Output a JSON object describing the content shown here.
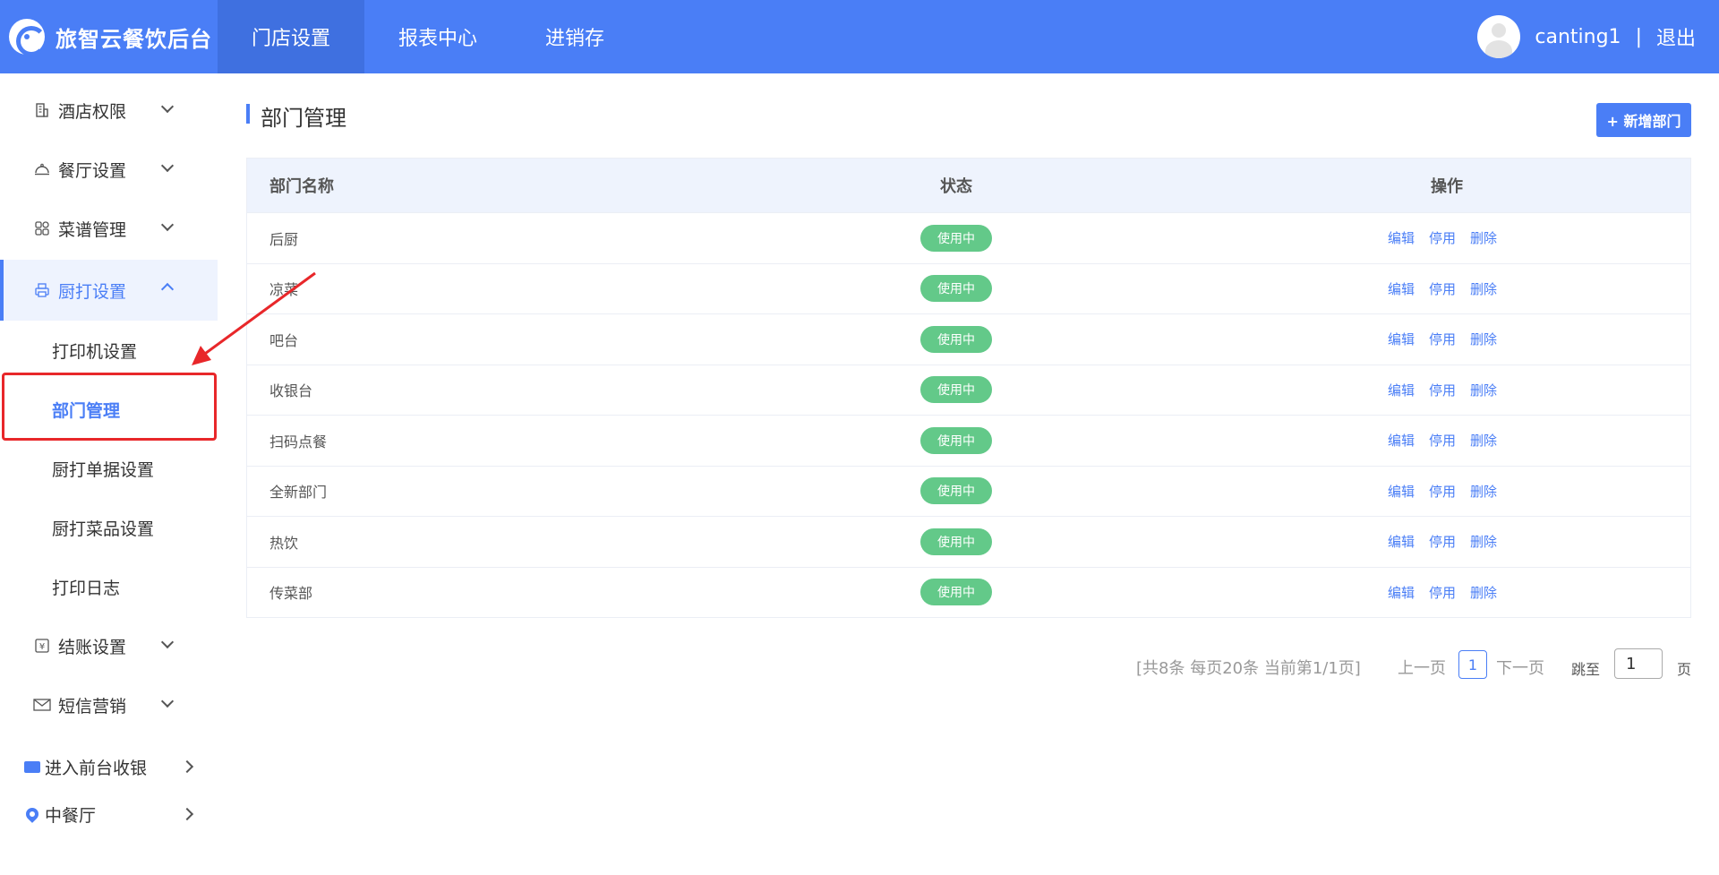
{
  "app": {
    "title": "旅智云餐饮后台"
  },
  "topnav": [
    {
      "label": "门店设置",
      "active": true
    },
    {
      "label": "报表中心",
      "active": false
    },
    {
      "label": "进销存",
      "active": false
    }
  ],
  "user": {
    "name": "canting1",
    "separator": "|",
    "logout": "退出"
  },
  "sidebar": {
    "groups": [
      {
        "label": "酒店权限",
        "icon": "building-icon"
      },
      {
        "label": "餐厅设置",
        "icon": "dish-cover-icon"
      },
      {
        "label": "菜谱管理",
        "icon": "grid-icon"
      },
      {
        "label": "厨打设置",
        "icon": "printer-icon",
        "open": true
      },
      {
        "label": "结账设置",
        "icon": "cashier-icon"
      },
      {
        "label": "短信营销",
        "icon": "mail-icon"
      }
    ],
    "subitems": [
      {
        "label": "打印机设置"
      },
      {
        "label": "部门管理",
        "active": true
      },
      {
        "label": "厨打单据设置"
      },
      {
        "label": "厨打菜品设置"
      },
      {
        "label": "打印日志"
      }
    ],
    "bottom": [
      {
        "label": "进入前台收银",
        "icon": "cash-register-icon"
      },
      {
        "label": "中餐厅",
        "icon": "location-pin-icon"
      }
    ]
  },
  "main": {
    "title": "部门管理",
    "add_button": "+ 新增部门",
    "table": {
      "headers": [
        "部门名称",
        "状态",
        "操作"
      ],
      "rows": [
        {
          "name": "后厨",
          "status": "使用中"
        },
        {
          "name": "凉菜",
          "status": "使用中"
        },
        {
          "name": "吧台",
          "status": "使用中"
        },
        {
          "name": "收银台",
          "status": "使用中"
        },
        {
          "name": "扫码点餐",
          "status": "使用中"
        },
        {
          "name": "全新部门",
          "status": "使用中"
        },
        {
          "name": "热饮",
          "status": "使用中"
        },
        {
          "name": "传菜部",
          "status": "使用中"
        }
      ],
      "actions": [
        "编辑",
        "停用",
        "删除"
      ]
    },
    "pager": {
      "info": "[共8条 每页20条 当前第1/1页]",
      "prev": "上一页",
      "current": "1",
      "next": "下一页",
      "goto_label": "跳至",
      "goto_value": "1",
      "page_label": "页"
    }
  },
  "colors": {
    "primary": "#4a7ef6",
    "status_green": "#63c989",
    "annotation_red": "#e8272a"
  }
}
